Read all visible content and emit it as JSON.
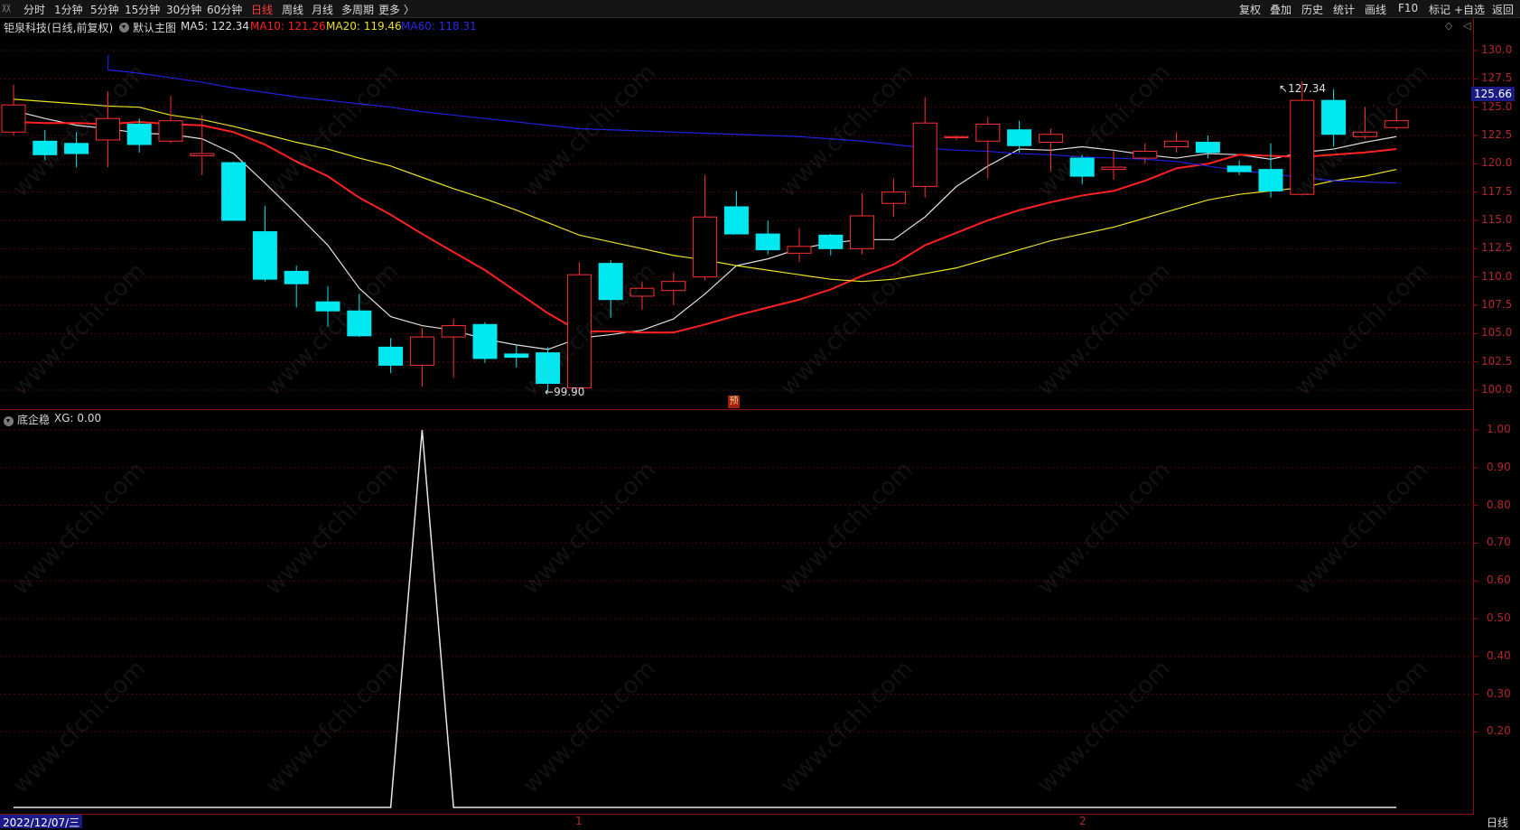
{
  "toolbar": {
    "left_items": [
      "分时",
      "1分钟",
      "5分钟",
      "15分钟",
      "30分钟",
      "60分钟",
      "日线",
      "周线",
      "月线",
      "多周期",
      "更多 〉"
    ],
    "active": "日线",
    "right_items": [
      "复权",
      "叠加",
      "历史",
      "统计",
      "画线",
      "F10",
      "标记",
      "+自选",
      "返回"
    ]
  },
  "main": {
    "stock_title": "钜泉科技(日线,前复权)",
    "template": "默认主图",
    "ma5": "MA5: 122.34",
    "ma10": "MA10: 121.26",
    "ma20": "MA20: 119.46",
    "ma60": "MA60: 118.31",
    "colors": {
      "ma5": "#e0e0e0",
      "ma10": "#ff2020",
      "ma20": "#e8e020",
      "ma60": "#2020e0",
      "up": "#ff3030",
      "down": "#00e8ef"
    },
    "current_price": "125.66",
    "high_label": "127.34",
    "low_label": "99.90",
    "marker": "预",
    "y_ticks": [
      "130.0",
      "127.5",
      "125.0",
      "122.5",
      "120.0",
      "117.5",
      "115.0",
      "112.5",
      "110.0",
      "107.5",
      "105.0",
      "102.5",
      "100.0"
    ]
  },
  "indicator": {
    "name": "底企稳",
    "value": "XG: 0.00",
    "y_ticks": [
      "1.00",
      "0.90",
      "0.80",
      "0.70",
      "0.60",
      "0.50",
      "0.40",
      "0.30",
      "0.20"
    ]
  },
  "status": {
    "date": "2022/12/07/三",
    "month1": "1",
    "month2": "2",
    "period": "日线"
  },
  "watermark": "www.cfchi.com",
  "chart_data": {
    "type": "candlestick",
    "ylim": [
      99,
      131.5
    ],
    "candles": [
      {
        "o": 122.8,
        "h": 127.0,
        "l": 122.5,
        "c": 125.2
      },
      {
        "o": 122.0,
        "h": 123.0,
        "l": 120.3,
        "c": 120.8
      },
      {
        "o": 121.8,
        "h": 122.8,
        "l": 119.7,
        "c": 120.9
      },
      {
        "o": 122.1,
        "h": 126.4,
        "l": 119.7,
        "c": 124.0
      },
      {
        "o": 123.5,
        "h": 124.0,
        "l": 121.0,
        "c": 121.7
      },
      {
        "o": 122.0,
        "h": 126.0,
        "l": 121.8,
        "c": 123.8
      },
      {
        "o": 120.7,
        "h": 124.3,
        "l": 119.0,
        "c": 120.9
      },
      {
        "o": 120.1,
        "h": 120.2,
        "l": 115.0,
        "c": 115.0
      },
      {
        "o": 114.0,
        "h": 116.3,
        "l": 109.6,
        "c": 109.8
      },
      {
        "o": 110.5,
        "h": 111.0,
        "l": 107.3,
        "c": 109.4
      },
      {
        "o": 107.8,
        "h": 109.2,
        "l": 105.6,
        "c": 107.0
      },
      {
        "o": 107.0,
        "h": 108.5,
        "l": 104.7,
        "c": 104.8
      },
      {
        "o": 103.8,
        "h": 104.6,
        "l": 101.5,
        "c": 102.2
      },
      {
        "o": 102.2,
        "h": 105.5,
        "l": 100.3,
        "c": 104.7
      },
      {
        "o": 104.7,
        "h": 106.3,
        "l": 101.1,
        "c": 105.7
      },
      {
        "o": 105.8,
        "h": 106.0,
        "l": 102.4,
        "c": 102.8
      },
      {
        "o": 103.2,
        "h": 104.0,
        "l": 102.0,
        "c": 102.9
      },
      {
        "o": 103.3,
        "h": 103.8,
        "l": 99.9,
        "c": 100.6
      },
      {
        "o": 100.2,
        "h": 111.3,
        "l": 100.0,
        "c": 110.2
      },
      {
        "o": 111.2,
        "h": 111.5,
        "l": 106.4,
        "c": 108.0
      },
      {
        "o": 108.3,
        "h": 109.6,
        "l": 107.1,
        "c": 109.0
      },
      {
        "o": 108.8,
        "h": 110.4,
        "l": 107.5,
        "c": 109.6
      },
      {
        "o": 110.0,
        "h": 119.0,
        "l": 109.7,
        "c": 115.3
      },
      {
        "o": 116.2,
        "h": 117.6,
        "l": 113.8,
        "c": 113.8
      },
      {
        "o": 113.8,
        "h": 115.0,
        "l": 112.0,
        "c": 112.4
      },
      {
        "o": 112.1,
        "h": 114.3,
        "l": 111.3,
        "c": 112.7
      },
      {
        "o": 113.7,
        "h": 113.8,
        "l": 111.9,
        "c": 112.5
      },
      {
        "o": 112.5,
        "h": 117.4,
        "l": 112.0,
        "c": 115.4
      },
      {
        "o": 116.5,
        "h": 118.7,
        "l": 115.3,
        "c": 117.5
      },
      {
        "o": 118.0,
        "h": 125.9,
        "l": 117.0,
        "c": 123.6
      },
      {
        "o": 122.3,
        "h": 122.5,
        "l": 122.1,
        "c": 122.4
      },
      {
        "o": 122.0,
        "h": 124.1,
        "l": 118.7,
        "c": 123.5
      },
      {
        "o": 123.0,
        "h": 123.8,
        "l": 121.0,
        "c": 121.6
      },
      {
        "o": 121.9,
        "h": 123.1,
        "l": 119.3,
        "c": 122.6
      },
      {
        "o": 120.5,
        "h": 120.8,
        "l": 118.2,
        "c": 118.9
      },
      {
        "o": 119.5,
        "h": 121.1,
        "l": 118.6,
        "c": 119.7
      },
      {
        "o": 120.5,
        "h": 121.8,
        "l": 120.0,
        "c": 121.1
      },
      {
        "o": 121.5,
        "h": 122.8,
        "l": 121.0,
        "c": 122.0
      },
      {
        "o": 121.9,
        "h": 122.5,
        "l": 120.5,
        "c": 121.0
      },
      {
        "o": 119.8,
        "h": 120.3,
        "l": 119.0,
        "c": 119.3
      },
      {
        "o": 119.5,
        "h": 121.8,
        "l": 117.0,
        "c": 117.6
      },
      {
        "o": 117.3,
        "h": 127.3,
        "l": 117.2,
        "c": 125.6
      },
      {
        "o": 125.6,
        "h": 126.6,
        "l": 121.5,
        "c": 122.6
      },
      {
        "o": 122.4,
        "h": 125.0,
        "l": 122.2,
        "c": 122.8
      },
      {
        "o": 123.2,
        "h": 124.9,
        "l": 123.0,
        "c": 123.8
      }
    ],
    "ma": [
      {
        "name": "MA5",
        "values": [
          124.7,
          124.0,
          123.4,
          123.1,
          122.7,
          122.6,
          122.2,
          120.9,
          118.3,
          115.6,
          112.8,
          109.0,
          106.5,
          105.7,
          105.3,
          104.5,
          104.0,
          103.6,
          104.6,
          104.9,
          105.3,
          106.3,
          108.5,
          111.0,
          111.6,
          112.5,
          113.0,
          113.3,
          113.3,
          115.3,
          118.0,
          119.8,
          121.3,
          121.2,
          121.5,
          121.2,
          120.8,
          120.5,
          120.9,
          120.8,
          120.4,
          121.0,
          121.3,
          121.9,
          122.4
        ]
      },
      {
        "name": "MA10",
        "values": [
          123.7,
          123.6,
          123.6,
          123.5,
          123.7,
          123.5,
          123.4,
          122.8,
          121.7,
          120.2,
          118.9,
          117.0,
          115.5,
          113.8,
          112.2,
          110.6,
          108.7,
          106.8,
          105.2,
          105.2,
          105.1,
          105.1,
          105.8,
          106.6,
          107.3,
          108.0,
          108.9,
          110.1,
          111.1,
          112.8,
          113.9,
          115.0,
          115.9,
          116.6,
          117.2,
          117.6,
          118.5,
          119.6,
          120.0,
          120.8,
          120.7,
          120.6,
          120.8,
          121.0,
          121.3
        ]
      },
      {
        "name": "MA20",
        "values": [
          125.7,
          125.5,
          125.3,
          125.1,
          125.0,
          124.3,
          123.9,
          123.3,
          122.6,
          121.9,
          121.3,
          120.5,
          119.8,
          118.8,
          117.8,
          116.9,
          115.9,
          114.8,
          113.7,
          113.1,
          112.5,
          111.9,
          111.5,
          111.0,
          110.6,
          110.2,
          109.8,
          109.6,
          109.8,
          110.3,
          110.8,
          111.6,
          112.4,
          113.2,
          113.8,
          114.4,
          115.2,
          116.0,
          116.8,
          117.3,
          117.6,
          117.9,
          118.5,
          118.9,
          119.5
        ]
      },
      {
        "name": "MA60",
        "values": [
          null,
          null,
          null,
          128.3,
          128.0,
          127.6,
          127.2,
          126.7,
          126.3,
          125.9,
          125.6,
          125.3,
          125.0,
          124.6,
          124.3,
          124.0,
          123.7,
          123.4,
          123.1,
          123.0,
          122.9,
          122.8,
          122.7,
          122.6,
          122.5,
          122.4,
          122.2,
          122.0,
          121.7,
          121.4,
          121.2,
          121.1,
          120.9,
          120.8,
          120.6,
          120.5,
          120.4,
          120.2,
          119.8,
          119.4,
          119.1,
          118.8,
          118.5,
          118.4,
          118.3
        ]
      }
    ],
    "indicator_values": [
      0,
      0,
      0,
      0,
      0,
      0,
      0,
      0,
      0,
      0,
      0,
      0,
      0,
      1,
      0,
      0,
      0,
      0,
      0,
      0,
      0,
      0,
      0,
      0,
      0,
      0,
      0,
      0,
      0,
      0,
      0,
      0,
      0,
      0,
      0,
      0,
      0,
      0,
      0,
      0,
      0,
      0,
      0,
      0,
      0
    ]
  }
}
